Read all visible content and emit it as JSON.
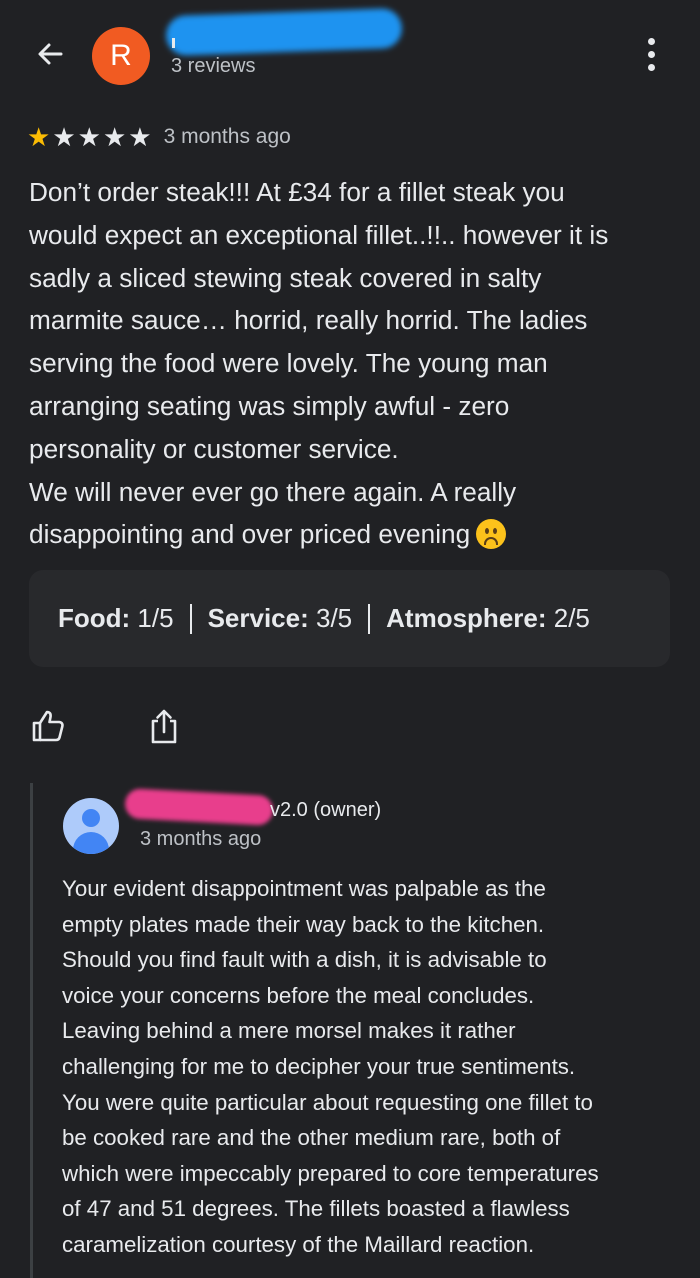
{
  "header": {
    "back_icon": "arrow-back-icon",
    "avatar_letter": "R",
    "avatar_color": "#f15b22",
    "review_count": "3 reviews",
    "more_icon": "more-vert-icon"
  },
  "review": {
    "rating": 1,
    "max_rating": 5,
    "star_color": "#fbbc04",
    "date": "3 months ago",
    "text": "Don’t order steak!!! At £34 for a fillet steak you\nwould expect an exceptional fillet..!!.. however it is\nsadly a sliced stewing steak covered in salty\nmarmite sauce… horrid, really horrid. The ladies\nserving the food were lovely. The young man\narranging seating was simply awful - zero\npersonality or customer service.\nWe will never ever go there again. A really\ndisappointing and over priced evening",
    "emoji": "sad-face-emoji"
  },
  "sub_ratings": [
    {
      "label": "Food:",
      "value": "1/5"
    },
    {
      "label": "Service:",
      "value": "3/5"
    },
    {
      "label": "Atmosphere:",
      "value": "2/5"
    }
  ],
  "actions": {
    "like_icon": "thumbs-up-icon",
    "share_icon": "share-icon"
  },
  "owner_reply": {
    "name_suffix": "v2.0 (owner)",
    "date": "3 months ago",
    "avatar_icon": "person-icon",
    "text": "Your evident disappointment was palpable as the\nempty plates made their way back to the kitchen.\nShould you find fault with a dish, it is advisable to\nvoice your concerns before the meal concludes.\nLeaving behind a mere morsel makes it rather\nchallenging for me to decipher your true sentiments.\nYou were quite particular about requesting one fillet to\nbe cooked rare and the other medium rare, both of\nwhich were impeccably prepared to core temperatures\nof 47 and 51 degrees. The fillets boasted a flawless\ncaramelization courtesy of the Maillard reaction."
  }
}
